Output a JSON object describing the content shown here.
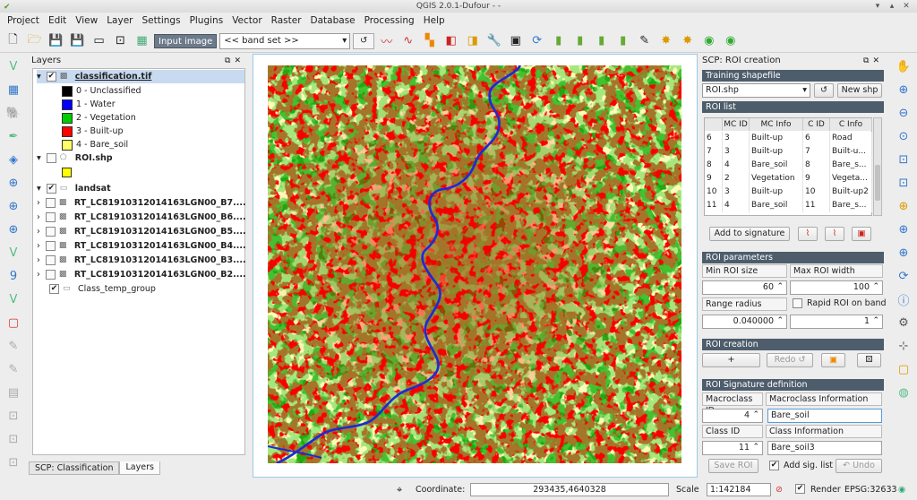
{
  "window": {
    "title": "QGIS 2.0.1-Dufour - -"
  },
  "menu": [
    "Project",
    "Edit",
    "View",
    "Layer",
    "Settings",
    "Plugins",
    "Vector",
    "Raster",
    "Database",
    "Processing",
    "Help"
  ],
  "toolbar": {
    "input_image_label": "Input image",
    "band_set_value": "<< band set >>"
  },
  "layers_panel": {
    "title": "Layers",
    "items": [
      {
        "label": "classification.tif"
      },
      {
        "label": "0 - Unclassified",
        "color": "#000000"
      },
      {
        "label": "1 - Water",
        "color": "#0000ff"
      },
      {
        "label": "2 - Vegetation",
        "color": "#00cc00"
      },
      {
        "label": "3 - Built-up",
        "color": "#ff0000"
      },
      {
        "label": "4 - Bare_soil",
        "color": "#ffff66"
      },
      {
        "label": "ROI.shp"
      },
      {
        "label": "landsat"
      },
      {
        "label": "RT_LC81910312014163LGN00_B7...."
      },
      {
        "label": "RT_LC81910312014163LGN00_B6...."
      },
      {
        "label": "RT_LC81910312014163LGN00_B5...."
      },
      {
        "label": "RT_LC81910312014163LGN00_B4...."
      },
      {
        "label": "RT_LC81910312014163LGN00_B3...."
      },
      {
        "label": "RT_LC81910312014163LGN00_B2...."
      },
      {
        "label": "Class_temp_group"
      }
    ],
    "tabs": [
      "SCP: Classification",
      "Layers"
    ]
  },
  "map": {
    "class_colors": {
      "vegetation": "#1faa11",
      "builtup": "#f20000",
      "bare_soil": "#f8f87c",
      "water": "#1a2bd8"
    }
  },
  "scp": {
    "title": "SCP: ROI creation",
    "training_shapefile": {
      "header": "Training shapefile",
      "value": "ROI.shp",
      "new_label": "New shp"
    },
    "roi_list": {
      "header": "ROI list",
      "columns": [
        "",
        "MC ID",
        "MC Info",
        "C ID",
        "C Info"
      ],
      "rows": [
        [
          "6",
          "3",
          "Built-up",
          "6",
          "Road"
        ],
        [
          "7",
          "3",
          "Built-up",
          "7",
          "Built-u..."
        ],
        [
          "8",
          "4",
          "Bare_soil",
          "8",
          "Bare_s..."
        ],
        [
          "9",
          "2",
          "Vegetation",
          "9",
          "Vegeta..."
        ],
        [
          "10",
          "3",
          "Built-up",
          "10",
          "Built-up2"
        ],
        [
          "11",
          "4",
          "Bare_soil",
          "11",
          "Bare_s..."
        ]
      ],
      "add_signature_label": "Add to signature"
    },
    "roi_parameters": {
      "header": "ROI parameters",
      "min_roi_size_label": "Min ROI size",
      "max_roi_width_label": "Max ROI width",
      "min_roi_size": "60",
      "max_roi_width": "100",
      "range_radius_label": "Range radius",
      "rapid_roi_label": "Rapid ROI on band",
      "range_radius": "0.040000",
      "rapid_band": "1"
    },
    "roi_creation": {
      "header": "ROI creation",
      "plus_label": "+",
      "redo_label": "Redo ↺"
    },
    "signature_definition": {
      "header": "ROI Signature definition",
      "macroclass_id_label": "Macroclass ID",
      "macroclass_info_label": "Macroclass Information",
      "macroclass_id": "4",
      "macroclass_info": "Bare_soil",
      "class_id_label": "Class ID",
      "class_info_label": "Class Information",
      "class_id": "11",
      "class_info": "Bare_soil3",
      "save_roi_label": "Save ROI",
      "add_sig_list_label": "Add sig. list",
      "undo_label": "↶ Undo"
    }
  },
  "status": {
    "coordinate_label": "Coordinate:",
    "coordinate": "293435,4640328",
    "scale_label": "Scale",
    "scale": "1:142184",
    "render_label": "Render",
    "crs": "EPSG:32633"
  }
}
